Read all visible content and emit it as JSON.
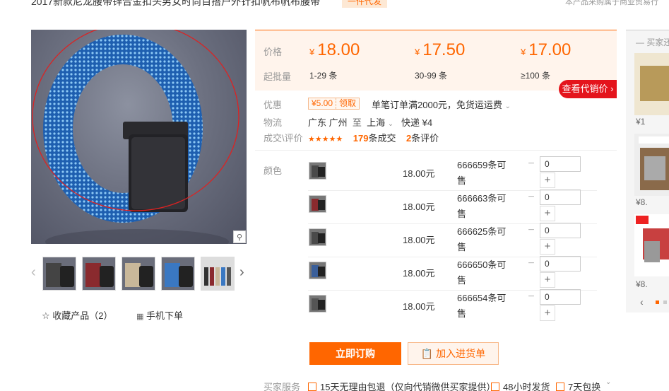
{
  "title": "2017新款尼龙腰带锌合金扣头男女时尚百搭户外针扣帆布帆布腰带",
  "title_badge": "一件代发",
  "top_note": "本产品采购属于商业贸易行",
  "gallery": {
    "zoom_icon": "magnifier-icon",
    "prev_icon": "chevron-left-icon",
    "next_icon": "chevron-right-icon",
    "thumbs": [
      {
        "color": "#5a5a5a"
      },
      {
        "color": "#8a2a2e"
      },
      {
        "color": "#c9b89a"
      },
      {
        "color": "#3a78c2"
      },
      {
        "color": "#555555"
      }
    ]
  },
  "actions": {
    "favorite_label": "收藏产品（2）",
    "mobile_label": "手机下单"
  },
  "price_box": {
    "price_label": "价格",
    "moq_label": "起批量",
    "currency": "¥",
    "tiers": [
      {
        "price": "18.00",
        "qty": "1-29 条"
      },
      {
        "price": "17.50",
        "qty": "30-99 条"
      },
      {
        "price": "17.00",
        "qty": "≥100 条"
      }
    ],
    "agent_button": "查看代销价"
  },
  "promo": {
    "label": "优惠",
    "coupon_value": "¥5.00",
    "coupon_action": "领取",
    "text": "单笔订单满2000元，免货运运费"
  },
  "logistics": {
    "label": "物流",
    "from": "广东 广州",
    "to_word": "至",
    "to": "上海",
    "method": "快递 ¥4"
  },
  "reviews": {
    "label": "成交\\评价",
    "stars": "★★★★★",
    "deals_count": "179",
    "deals_text": "条成交",
    "review_count": "2",
    "review_text": "条评价"
  },
  "variants": {
    "label": "颜色",
    "unit_suffix": "元",
    "stock_suffix": "条可售",
    "rows": [
      {
        "price": "18.00",
        "stock": "666659",
        "qty": "0",
        "color": "#4a4a4a"
      },
      {
        "price": "18.00",
        "stock": "666663",
        "qty": "0",
        "color": "#8a2a2e"
      },
      {
        "price": "18.00",
        "stock": "666625",
        "qty": "0",
        "color": "#4a4a4a"
      },
      {
        "price": "18.00",
        "stock": "666650",
        "qty": "0",
        "color": "#3a5f9a"
      },
      {
        "price": "18.00",
        "stock": "666654",
        "qty": "0",
        "color": "#555555"
      }
    ]
  },
  "buttons": {
    "buy_now": "立即订购",
    "add_to_list": "加入进货单"
  },
  "services": {
    "label": "买家服务",
    "items": [
      "15天无理由包退（仅向代销微供买家提供）",
      "48小时发货",
      "7天包换"
    ]
  },
  "sidebar": {
    "title": "买家还",
    "items": [
      {
        "price": "¥1",
        "color": "#b89a5a"
      },
      {
        "price": "¥8.",
        "color": "#8a6a4a"
      },
      {
        "price": "¥8.",
        "color": "#c84040"
      }
    ]
  },
  "colors": {
    "accent": "#ff6600",
    "agent_red": "#e4141c"
  }
}
